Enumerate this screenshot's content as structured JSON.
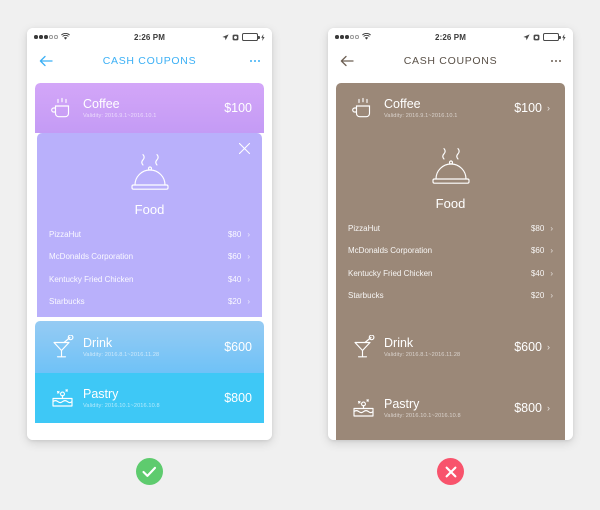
{
  "statusbar": {
    "time": "2:26 PM",
    "signal_filled": 3,
    "signal_hollow": 2,
    "wifi_icon": "wifi-icon",
    "location_icon": "location-arrow-icon",
    "alarm_icon": "alarm-icon",
    "battery_icon": "battery-icon",
    "charging_icon": "bolt-icon"
  },
  "navbar": {
    "back_icon": "back-arrow-icon",
    "title": "CASH COUPONS",
    "more_icon": "more-options-icon"
  },
  "coupons": [
    {
      "name": "Coffee",
      "validity": "Validity: 2016.9.1~2016.10.1",
      "amount": "$100",
      "icon": "coffee-cup-icon"
    },
    {
      "name": "Drink",
      "validity": "Validity: 2016.8.1~2016.11.28",
      "amount": "$600",
      "icon": "cocktail-glass-icon"
    },
    {
      "name": "Pastry",
      "validity": "Validity: 2016.10.1~2016.10.8",
      "amount": "$800",
      "icon": "cake-icon"
    }
  ],
  "food": {
    "label": "Food",
    "icon": "food-cloche-icon",
    "close_icon": "close-icon",
    "chevron": "›",
    "merchants": [
      {
        "name": "PizzaHut",
        "amount": "$80"
      },
      {
        "name": "McDonalds Corporation",
        "amount": "$60"
      },
      {
        "name": "Kentucky Fried Chicken",
        "amount": "$40"
      },
      {
        "name": "Starbucks",
        "amount": "$20"
      }
    ]
  },
  "verdicts": {
    "good": {
      "icon": "check-icon",
      "color": "#5ecb6e"
    },
    "bad": {
      "icon": "cross-icon",
      "color": "#f8536c"
    }
  },
  "theme": {
    "background": "#f0f0f0",
    "accent_blue": "#3cb0f5",
    "coffee_top": "#cf9ff8",
    "coffee_bottom": "#c49bf5",
    "food_panel": "#b9b0fb",
    "drink_top": "#8fc7f2",
    "drink_bottom": "#74c3f6",
    "pastry": "#3ec8f6",
    "bad_panel": "#9b8878",
    "nav_title_good": "#3cb0f5",
    "nav_title_bad": "#5a5148"
  }
}
